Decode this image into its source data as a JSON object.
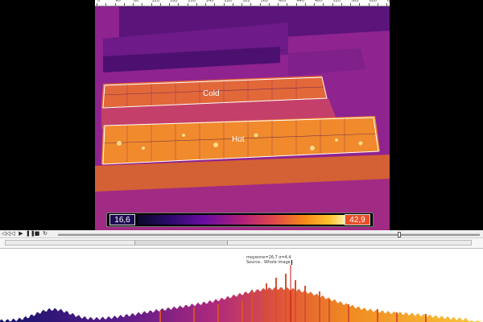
{
  "ruler": {
    "labels": [
      "0",
      "20",
      "40",
      "60",
      "80",
      "100",
      "120",
      "140",
      "160",
      "180",
      "200",
      "220",
      "240",
      "260",
      "280",
      "300",
      "320",
      "340",
      "360",
      "380",
      "400",
      "420",
      "440",
      "460",
      "480",
      "500",
      "520",
      "540",
      "560",
      "580",
      "600",
      "620",
      "640"
    ]
  },
  "thermal_image": {
    "rois": [
      {
        "name": "Cold",
        "label": "Cold"
      },
      {
        "name": "Hot",
        "label": "Hot"
      }
    ],
    "scale": {
      "min": "16,6",
      "max": "42,9"
    }
  },
  "player": {
    "controls": [
      {
        "name": "rewind-button",
        "glyph": "◁◁"
      },
      {
        "name": "step-back-button",
        "glyph": "◁"
      },
      {
        "name": "play-button",
        "glyph": "▶"
      },
      {
        "name": "pause-button",
        "glyph": "❚❚"
      },
      {
        "name": "stop-button",
        "glyph": "■"
      },
      {
        "name": "loop-button",
        "glyph": "↻"
      }
    ],
    "position_fraction": 0.81
  },
  "histogram": {
    "stats_line": "moyenne=26,7 σ=4,4",
    "source_label": "Source :",
    "source_value": "Whole image",
    "colors": {
      "low": "#14146a",
      "mid": "#c0387a",
      "high": "#f7b81c",
      "marker": "#d01010"
    }
  }
}
